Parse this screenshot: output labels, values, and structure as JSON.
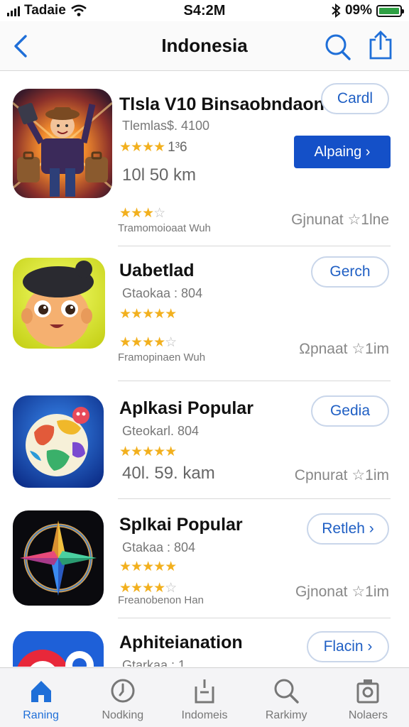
{
  "status_bar": {
    "carrier": "Tadaie",
    "time": "S4:2M",
    "battery_text": "09%",
    "battery_level": 1.0,
    "battery_color": "#2ea043"
  },
  "nav": {
    "title": "Indonesia",
    "accent": "#1f6fd8"
  },
  "apps": [
    {
      "name": "Tlsla V10 Binsaobndaon",
      "subtitle": "Tlemlas$. 4100",
      "stars_text": "★★★★",
      "rating": "1³6",
      "size": "10l 50 km",
      "bottom_stars": "★★★",
      "bottom_stars_empty": "☆",
      "caption": "Tramomoioaat Wuh",
      "meta": "Gjnunat ☆1lne",
      "button": "Cardl",
      "action_button": "Alpaing ›"
    },
    {
      "name": "Uabetlad",
      "subtitle": "Gtaokaa : 804",
      "stars_text": "★★★★★",
      "bottom_stars": "★★★★",
      "bottom_stars_empty": "☆",
      "caption": "Framopinaen Wuh",
      "meta": "Ωpnaat ☆1im",
      "button": "Gerch"
    },
    {
      "name": "Aplkasi Popular",
      "subtitle": "Gteokarl. 804",
      "stars_text": "★★★★★",
      "size": "40l. 59. kam",
      "meta": "Cpnurat ☆1im",
      "button": "Gedia"
    },
    {
      "name": "Splkai Popular",
      "subtitle": "Gtakaa : 804",
      "stars_text": "★★★★★",
      "bottom_stars": "★★★★",
      "bottom_stars_empty": "☆",
      "caption": "Freanobenon Han",
      "meta": "Gjnonat ☆1im",
      "button": "Retleh ›"
    },
    {
      "name": "Aphiteianation",
      "subtitle": "Gtarkaa : 1",
      "button": "Flacin ›"
    }
  ],
  "tabs": [
    {
      "label": "Raning",
      "icon": "home-icon",
      "active": true
    },
    {
      "label": "Nodking",
      "icon": "clock-icon"
    },
    {
      "label": "Indomeis",
      "icon": "tray-icon"
    },
    {
      "label": "Rarkimy",
      "icon": "search-icon"
    },
    {
      "label": "Nolaers",
      "icon": "media-icon"
    }
  ]
}
